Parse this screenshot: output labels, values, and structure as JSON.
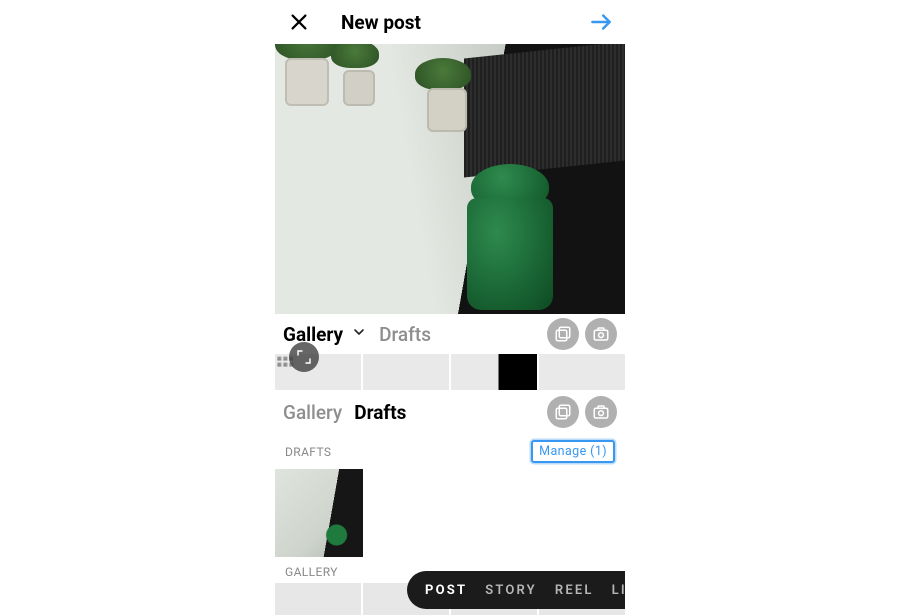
{
  "header": {
    "title": "New post"
  },
  "section1": {
    "gallery_label": "Gallery",
    "drafts_label": "Drafts"
  },
  "section2": {
    "gallery_label": "Gallery",
    "drafts_label": "Drafts"
  },
  "labels": {
    "drafts_heading": "DRAFTS",
    "gallery_heading": "GALLERY",
    "manage": "Manage (1)"
  },
  "modes": {
    "post": "POST",
    "story": "STORY",
    "reel": "REEL",
    "live_partial": "LI"
  },
  "icons": {
    "close": "close-icon",
    "next": "arrow-right-icon",
    "chevron": "chevron-down-icon",
    "multi": "multi-select-icon",
    "camera": "camera-icon",
    "expand": "expand-icon"
  }
}
